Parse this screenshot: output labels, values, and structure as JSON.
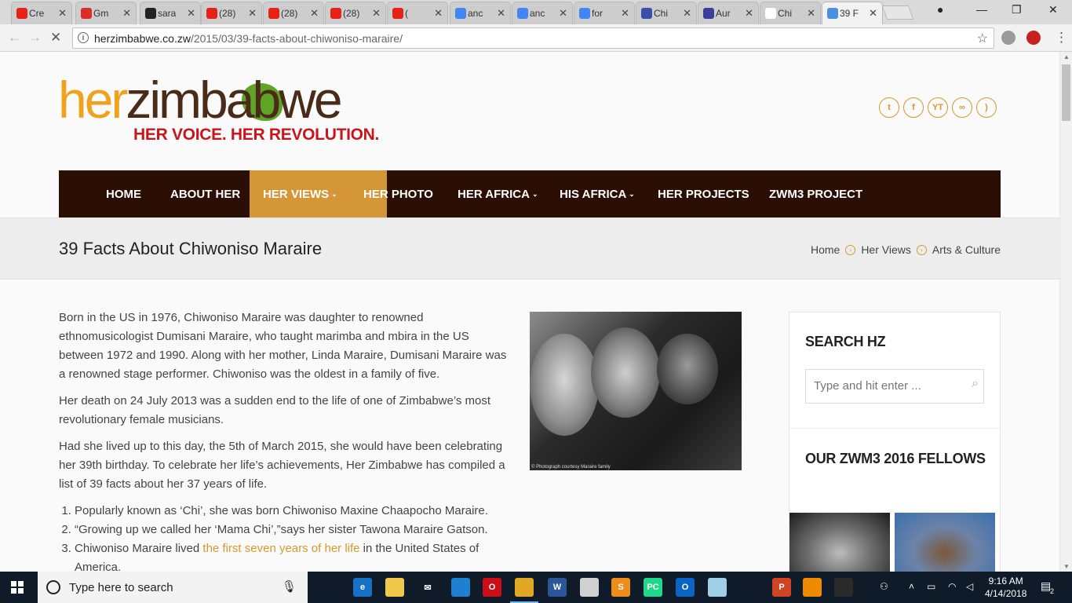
{
  "browser": {
    "tabs": [
      {
        "title": "Cre",
        "icon": "youtube-icon",
        "color": "#e62117"
      },
      {
        "title": "Gm",
        "icon": "gmail-icon",
        "color": "#d93025"
      },
      {
        "title": "sara",
        "icon": "github-icon",
        "color": "#222222"
      },
      {
        "title": "(28)",
        "icon": "youtube-icon",
        "color": "#e62117"
      },
      {
        "title": "(28)",
        "icon": "youtube-icon",
        "color": "#e62117"
      },
      {
        "title": "(28)",
        "icon": "youtube-icon",
        "color": "#e62117"
      },
      {
        "title": "(",
        "icon": "youtube-icon",
        "color": "#e62117"
      },
      {
        "title": "anc",
        "icon": "google-icon",
        "color": "#4285f4"
      },
      {
        "title": "anc",
        "icon": "google-icon",
        "color": "#4285f4"
      },
      {
        "title": "for",
        "icon": "google-icon",
        "color": "#4285f4"
      },
      {
        "title": "Chi",
        "icon": "music-icon",
        "color": "#3b4fa8"
      },
      {
        "title": "Aur",
        "icon": "s-icon",
        "color": "#3b3f9a"
      },
      {
        "title": "Chi",
        "icon": "wikipedia-icon",
        "color": "#ffffff"
      },
      {
        "title": "39 F",
        "icon": "loading-icon",
        "color": "#4a90e2"
      }
    ],
    "url_domain": "herzimbabwe.co.zw",
    "url_path": "/2015/03/39-facts-about-chiwoniso-maraire/"
  },
  "site": {
    "logo_her": "her",
    "logo_zim": "zimbabwe",
    "tagline": "HER VOICE. HER REVOLUTION.",
    "social": [
      {
        "label": "t",
        "icon": "twitter-icon"
      },
      {
        "label": "f",
        "icon": "facebook-icon"
      },
      {
        "label": "YT",
        "icon": "youtube-icon"
      },
      {
        "label": "∞",
        "icon": "flickr-icon"
      },
      {
        "label": ")",
        "icon": "rss-icon"
      }
    ],
    "nav": [
      {
        "label": "HOME",
        "dropdown": false,
        "active": false
      },
      {
        "label": "ABOUT HER",
        "dropdown": false,
        "active": false
      },
      {
        "label": "HER VIEWS",
        "dropdown": true,
        "active": true
      },
      {
        "label": "HER PHOTO",
        "dropdown": false,
        "active": false
      },
      {
        "label": "HER AFRICA",
        "dropdown": true,
        "active": false
      },
      {
        "label": "HIS AFRICA",
        "dropdown": true,
        "active": false
      },
      {
        "label": "HER PROJECTS",
        "dropdown": false,
        "active": false
      },
      {
        "label": "ZWM3 PROJECT",
        "dropdown": false,
        "active": false
      }
    ],
    "accent_color": "#d59637",
    "nav_bg": "#2c0f04"
  },
  "page": {
    "title": "39 Facts About Chiwoniso Maraire",
    "breadcrumbs": [
      "Home",
      "Her Views",
      "Arts & Culture"
    ],
    "paragraphs": [
      "Born in the US in 1976, Chiwoniso Maraire was daughter to renowned ethnomusicologist Dumisani Maraire, who taught marimba and mbira in the US between 1972 and 1990. Along with her mother, Linda Maraire, Dumisani Maraire was a renowned stage performer. Chiwoniso was the oldest in a family of five.",
      "Her death on 24 July 2013 was a sudden end to the life of one of Zimbabwe’s most revolutionary female musicians.",
      "Had she lived up to this day, the 5th of March 2015, she would have been celebrating her 39th birthday. To celebrate her life’s achievements, Her Zimbabwe has compiled a list of 39 facts about her 37 years of life."
    ],
    "facts": [
      {
        "text": "Popularly known as ‘Chi’, she was born Chiwoniso Maxine Chaapocho Maraire."
      },
      {
        "text": "“Growing up we called her ‘Mama Chi’,”says her sister Tawona Maraire Gatson."
      },
      {
        "text_before": "Chiwoniso Maraire lived ",
        "link": "the first seven years of her life",
        "text_after": " in the United States of America."
      }
    ],
    "photo_caption": "© Photograph courtesy Maraire family"
  },
  "sidebar": {
    "search_title": "SEARCH HZ",
    "search_placeholder": "Type and hit enter ...",
    "fellows_title": "OUR ZWM3 2016 FELLOWS"
  },
  "taskbar": {
    "search_text": "Type here to search",
    "time": "9:16 AM",
    "date": "4/14/2018",
    "notification_count": "2",
    "apps": [
      {
        "icon": "task-view-icon",
        "label": "",
        "color": "#101b2a"
      },
      {
        "icon": "edge-icon",
        "label": "e",
        "color": "#1572c4"
      },
      {
        "icon": "file-explorer-icon",
        "label": "",
        "color": "#f2c84b"
      },
      {
        "icon": "mail-icon",
        "label": "✉",
        "color": "#101b2a"
      },
      {
        "icon": "shark-icon",
        "label": "",
        "color": "#1f7fd0"
      },
      {
        "icon": "opera-icon",
        "label": "O",
        "color": "#cc0f16"
      },
      {
        "icon": "chrome-icon",
        "label": "",
        "color": "#e2a823"
      },
      {
        "icon": "word-icon",
        "label": "W",
        "color": "#2b579a"
      },
      {
        "icon": "paint-icon",
        "label": "",
        "color": "#d0d0d0"
      },
      {
        "icon": "sublime-icon",
        "label": "S",
        "color": "#f08c1a"
      },
      {
        "icon": "pycharm-icon",
        "label": "PC",
        "color": "#21d789"
      },
      {
        "icon": "outlook-icon",
        "label": "O",
        "color": "#0a64c4"
      },
      {
        "icon": "notes-icon",
        "label": "",
        "color": "#9fd0e8"
      },
      {
        "icon": "photos-icon",
        "label": "",
        "color": "#101b2a"
      },
      {
        "icon": "powerpoint-icon",
        "label": "P",
        "color": "#d04423"
      },
      {
        "icon": "vlc-icon",
        "label": "",
        "color": "#f08a00"
      },
      {
        "icon": "terminal-icon",
        "label": "",
        "color": "#2a2a2a"
      }
    ]
  }
}
